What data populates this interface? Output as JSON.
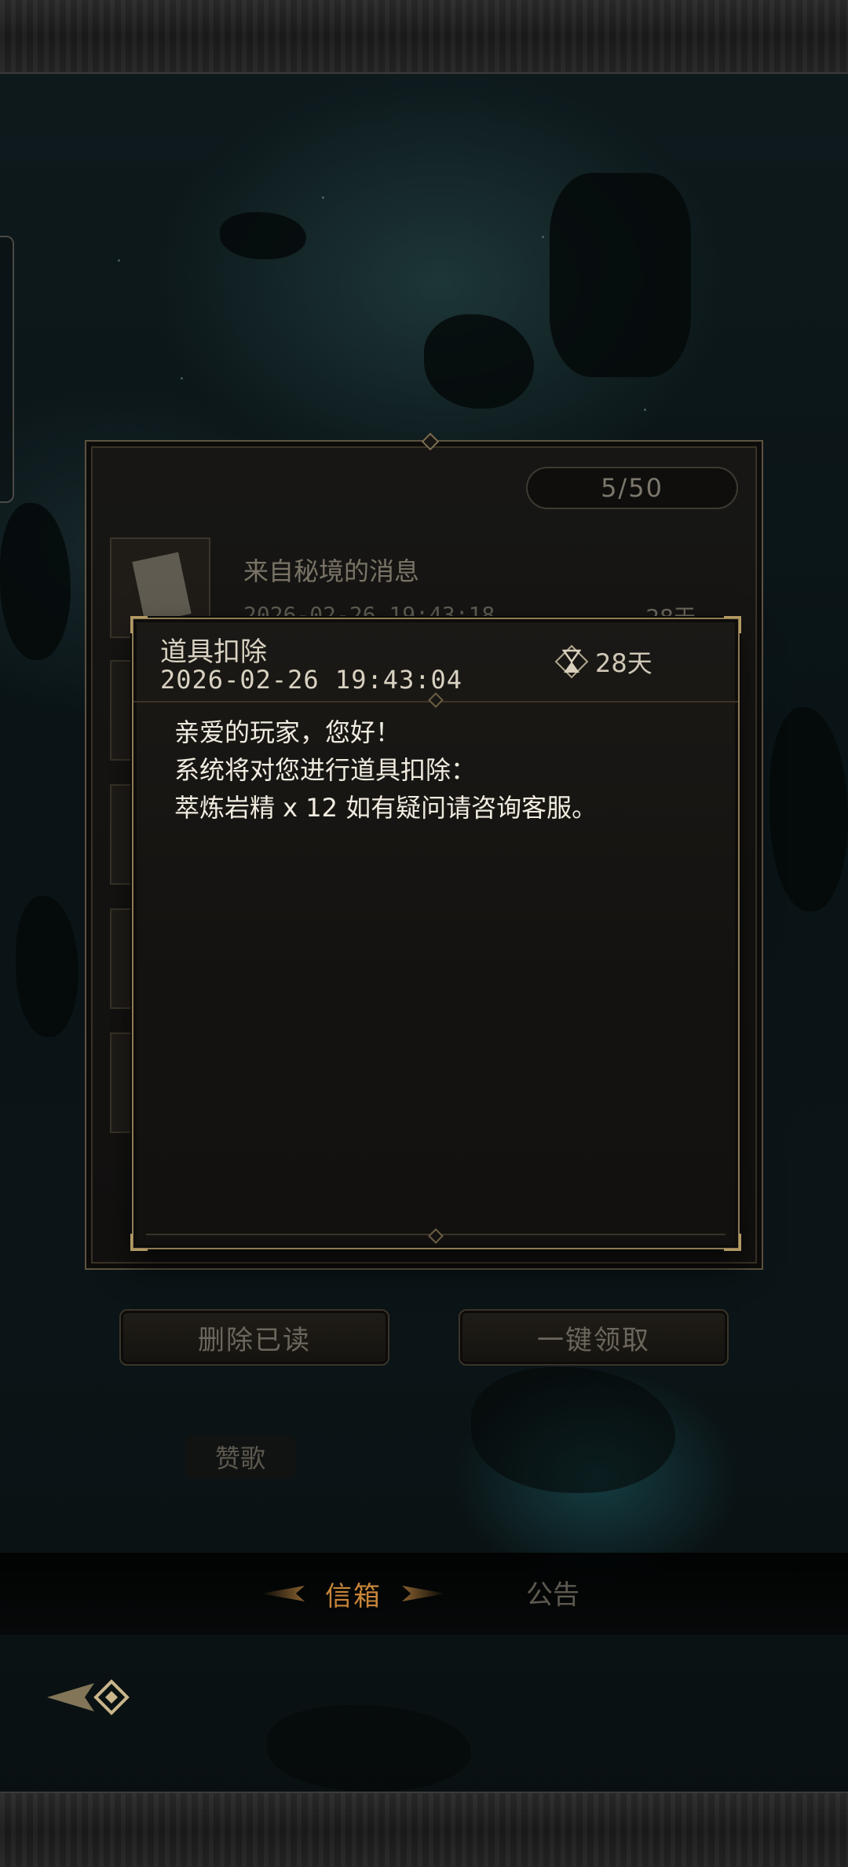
{
  "mailbox": {
    "count": "5/50",
    "items": [
      {
        "title": "来自秘境的消息",
        "date": "2026-02-26 19:43:18",
        "days": "28天"
      }
    ],
    "delete_read_label": "删除已读",
    "claim_all_label": "一键领取",
    "hymn_label": "赞歌"
  },
  "tabs": {
    "mail": "信箱",
    "notice": "公告"
  },
  "detail": {
    "title": "道具扣除",
    "date": "2026-02-26 19:43:04",
    "days": "28天",
    "lines": [
      "亲爱的玩家，您好！",
      "系统将对您进行道具扣除：",
      "萃炼岩精 x 12 如有疑问请咨询客服。"
    ]
  },
  "icons": {
    "expire": "hourglass-icon",
    "mail_thumb": "letter-icon",
    "back": "arrow-left-icon"
  },
  "colors": {
    "accent_gold": "#8c7b56",
    "active_tab": "#c8863a"
  }
}
